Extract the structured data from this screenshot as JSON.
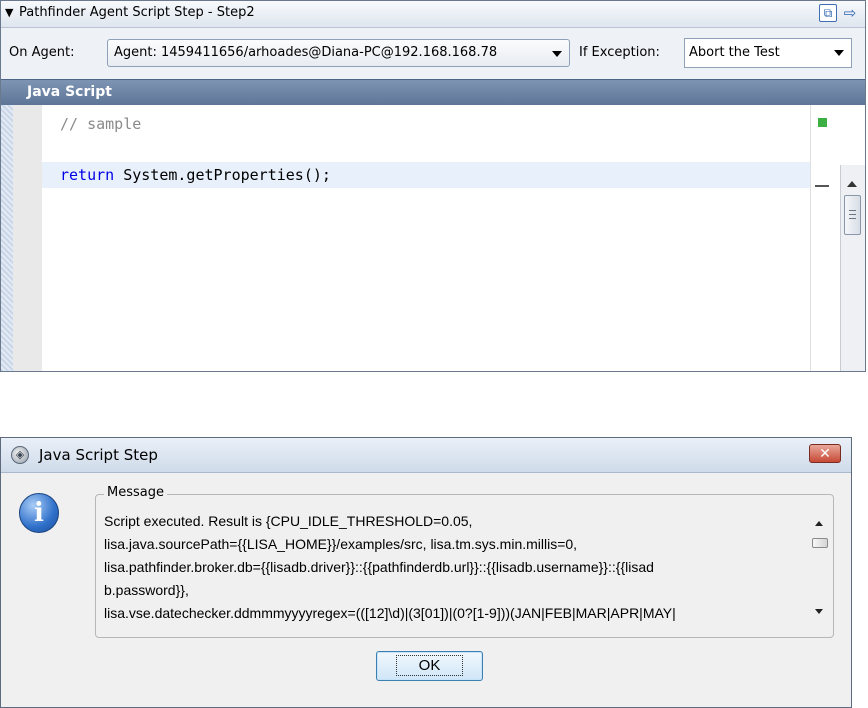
{
  "top_panel": {
    "title": "Pathfinder Agent Script Step - Step2",
    "collapse_glyph": "▼",
    "header_icons": [
      "expand-window-icon",
      "arrow-right-icon"
    ],
    "on_agent_label": "On Agent:",
    "agent_value": "Agent: 1459411656/arhoades@Diana-PC@192.168.168.78",
    "if_exception_label": "If Exception:",
    "exception_value": "Abort the Test",
    "section_title": "Java Script",
    "code": {
      "comment_line": "// sample",
      "return_keyword": "return",
      "return_rest": " System.getProperties();"
    }
  },
  "dialog": {
    "title": "Java Script Step",
    "close_glyph": "✕",
    "info_glyph": "i",
    "message_label": "Message",
    "message_lines": [
      "Script executed. Result is {CPU_IDLE_THRESHOLD=0.05,",
      "lisa.java.sourcePath={{LISA_HOME}}/examples/src, lisa.tm.sys.min.millis=0,",
      "lisa.pathfinder.broker.db={{lisadb.driver}}::{{pathfinderdb.url}}::{{lisadb.username}}::{{lisad",
      "b.password}},",
      "lisa.vse.datechecker.ddmmmyyyyregex=(([12]\\d)|(3[01])|(0?[1-9]))(JAN|FEB|MAR|APR|MAY|"
    ],
    "ok_label": "OK"
  },
  "colors": {
    "header_bar": "#5c7496",
    "keyword": "#0000e6",
    "comment": "#8a8a8a",
    "highlight_line": "#e8f0fb",
    "marker_green": "#3cb043",
    "close_red": "#c64a36"
  }
}
